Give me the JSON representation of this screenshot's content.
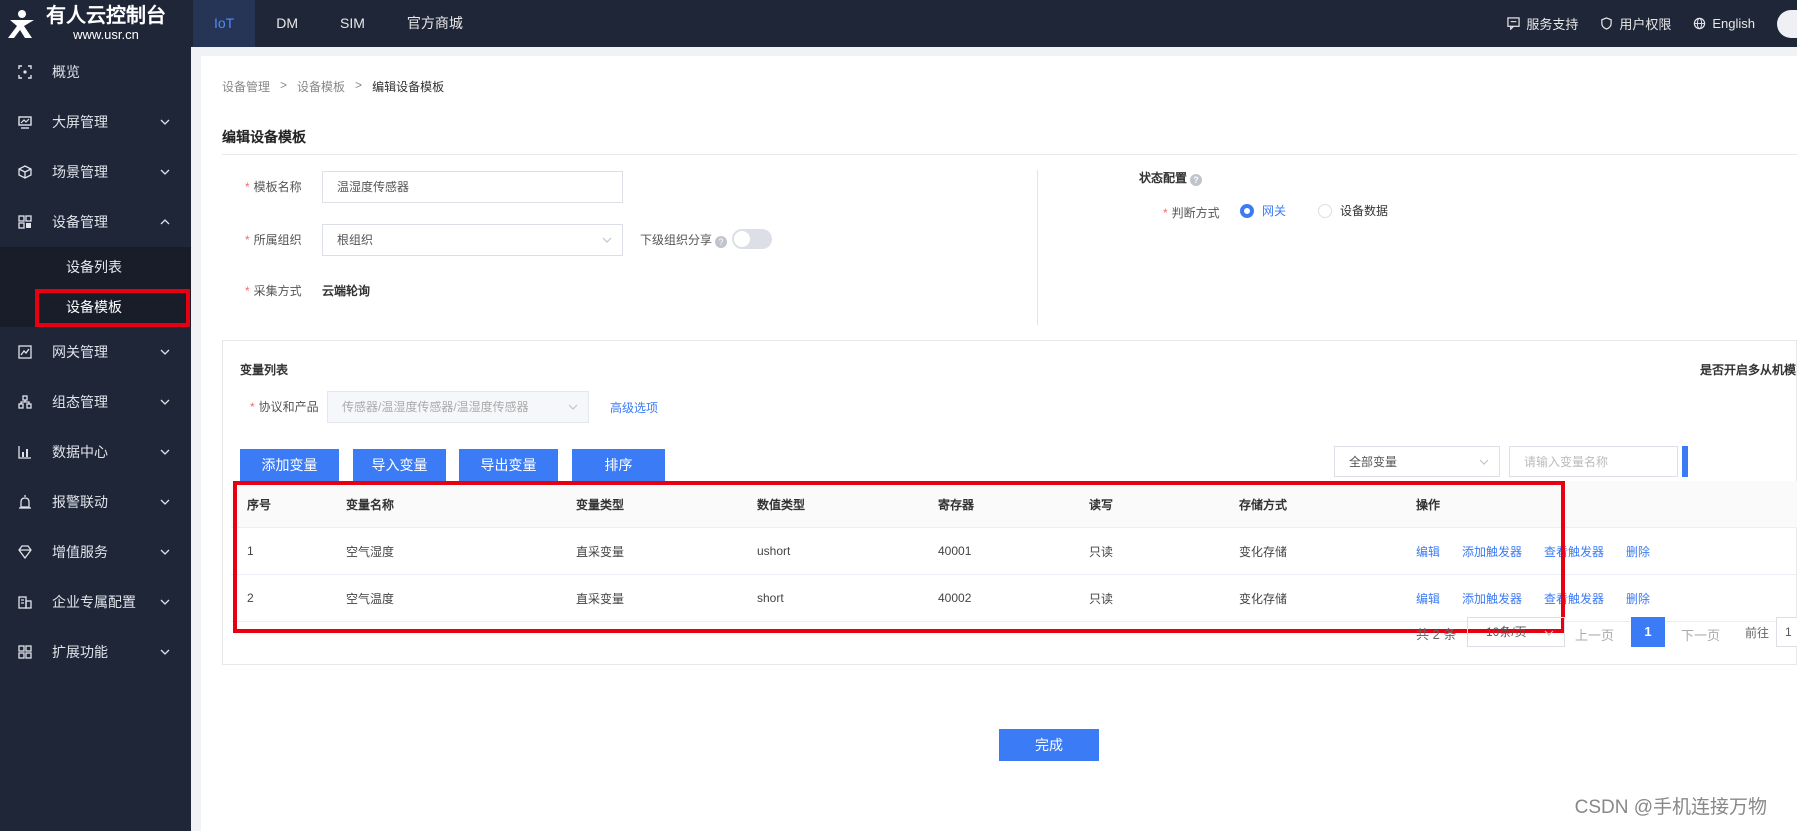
{
  "brand": {
    "title": "有人云控制台",
    "subtitle": "www.usr.cn"
  },
  "topnav": {
    "tabs": [
      {
        "label": "IoT"
      },
      {
        "label": "DM"
      },
      {
        "label": "SIM"
      },
      {
        "label": "官方商城"
      }
    ]
  },
  "topright": {
    "support": "服务支持",
    "permissions": "用户权限",
    "language": "English"
  },
  "sidebar": {
    "items": [
      {
        "label": "概览",
        "icon": "overview-icon"
      },
      {
        "label": "大屏管理",
        "icon": "screen-icon"
      },
      {
        "label": "场景管理",
        "icon": "scene-icon"
      },
      {
        "label": "设备管理",
        "icon": "device-icon"
      },
      {
        "label": "网关管理",
        "icon": "gateway-icon"
      },
      {
        "label": "组态管理",
        "icon": "config-icon"
      },
      {
        "label": "数据中心",
        "icon": "data-icon"
      },
      {
        "label": "报警联动",
        "icon": "alarm-icon"
      },
      {
        "label": "增值服务",
        "icon": "value-icon"
      },
      {
        "label": "企业专属配置",
        "icon": "enterprise-icon"
      },
      {
        "label": "扩展功能",
        "icon": "extend-icon"
      }
    ],
    "device_sub": [
      {
        "label": "设备列表"
      },
      {
        "label": "设备模板"
      }
    ]
  },
  "breadcrumb": {
    "items": [
      "设备管理",
      "设备模板",
      "编辑设备模板"
    ]
  },
  "page_title": "编辑设备模板",
  "form": {
    "name_label": "模板名称",
    "name_value": "温湿度传感器",
    "org_label": "所属组织",
    "org_value": "根组织",
    "share_label": "下级组织分享",
    "collect_label": "采集方式",
    "collect_value": "云端轮询"
  },
  "status": {
    "title": "状态配置",
    "judge_label": "判断方式",
    "options": [
      "网关",
      "设备数据"
    ],
    "selected": "网关"
  },
  "vars": {
    "title": "变量列表",
    "multi_slave": "是否开启多从机模",
    "protocol_label": "协议和产品",
    "protocol_value": "传感器/温湿度传感器/温湿度传感器",
    "advanced": "高级选项",
    "buttons": [
      "添加变量",
      "导入变量",
      "导出变量",
      "排序"
    ],
    "filter_value": "全部变量",
    "search_placeholder": "请输入变量名称"
  },
  "table": {
    "headers": [
      "序号",
      "变量名称",
      "变量类型",
      "数值类型",
      "寄存器",
      "读写",
      "存储方式",
      "操作"
    ],
    "rows": [
      {
        "no": "1",
        "name": "空气湿度",
        "type": "直采变量",
        "dtype": "ushort",
        "reg": "40001",
        "rw": "只读",
        "store": "变化存储"
      },
      {
        "no": "2",
        "name": "空气温度",
        "type": "直采变量",
        "dtype": "short",
        "reg": "40002",
        "rw": "只读",
        "store": "变化存储"
      }
    ],
    "ops": [
      "编辑",
      "添加触发器",
      "查看触发器",
      "删除"
    ]
  },
  "pager": {
    "total": "共 2 条",
    "size": "10条/页",
    "prev": "上一页",
    "page": "1",
    "next": "下一页",
    "goto": "前往",
    "goto_value": "1"
  },
  "done": "完成",
  "watermark": "CSDN @手机连接万物",
  "colors": {
    "primary": "#3c7bf6",
    "sidebar": "#1f2637",
    "highlight": "#e60012"
  }
}
